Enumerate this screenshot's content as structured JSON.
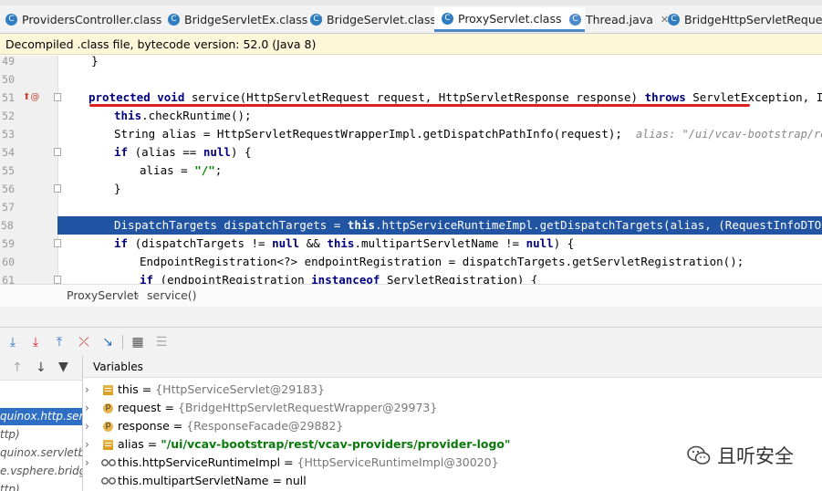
{
  "tabs": [
    {
      "label": "ProvidersController.class",
      "icon": "class-icon",
      "active": false
    },
    {
      "label": "BridgeServletEx.class",
      "icon": "class-icon",
      "active": false
    },
    {
      "label": "BridgeServlet.class",
      "icon": "class-icon",
      "active": false
    },
    {
      "label": "ProxyServlet.class",
      "icon": "class-icon",
      "active": true
    },
    {
      "label": "Thread.java",
      "icon": "java-class-icon",
      "active": false
    },
    {
      "label": "BridgeHttpServletRequestWr",
      "icon": "class-icon",
      "active": false
    }
  ],
  "info_bar": "Decompiled .class file, bytecode version: 52.0 (Java 8)",
  "code": {
    "lines": [
      {
        "n": "49",
        "text": "    }"
      },
      {
        "n": "50",
        "text": ""
      },
      {
        "n": "51",
        "text": "protected void service(HttpServletRequest request, HttpServletResponse response) throws ServletException, IOExcepti"
      },
      {
        "n": "52",
        "text": "    this.checkRuntime();"
      },
      {
        "n": "53",
        "text": "    String alias = HttpServletRequestWrapperImpl.getDispatchPathInfo(request);"
      },
      {
        "n": "54",
        "text": "    if (alias == null) {"
      },
      {
        "n": "55",
        "text": "        alias = \"/\";"
      },
      {
        "n": "56",
        "text": "    }"
      },
      {
        "n": "57",
        "text": ""
      },
      {
        "n": "58",
        "text": "    DispatchTargets dispatchTargets = this.httpServiceRuntimeImpl.getDispatchTargets(alias, (RequestInfoDTO)null);"
      },
      {
        "n": "59",
        "text": "    if (dispatchTargets != null && this.multipartServletName != null) {"
      },
      {
        "n": "60",
        "text": "        EndpointRegistration<?> endpointRegistration = dispatchTargets.getServletRegistration();"
      },
      {
        "n": "61",
        "text": "        if (endpointRegistration instanceof ServletRegistration) {"
      }
    ],
    "inline_hint": "alias: \"/ui/vcav-bootstrap/rest/vca"
  },
  "breadcrumb": [
    "ProxyServlet",
    "service()"
  ],
  "frames": [
    "quinox.http.servlet.",
    "ttp)",
    "quinox.servletbric",
    "e.vsphere.bridge,",
    "ttp)"
  ],
  "variables": {
    "header": "Variables",
    "rows": [
      {
        "icon": "field-icon",
        "name": "this",
        "value": "{HttpServiceServlet@29183}",
        "expandable": true
      },
      {
        "icon": "param-icon",
        "name": "request",
        "value": "{BridgeHttpServletRequestWrapper@29973}",
        "expandable": true
      },
      {
        "icon": "param-icon",
        "name": "response",
        "value": "{ResponseFacade@29882}",
        "expandable": true
      },
      {
        "icon": "field-icon",
        "name": "alias",
        "value": "\"/ui/vcav-bootstrap/rest/vcav-providers/provider-logo\"",
        "expandable": true
      },
      {
        "icon": "watch-icon",
        "name": "this.httpServiceRuntimeImpl",
        "value": "{HttpServiceRuntimeImpl@30020}",
        "expandable": true
      },
      {
        "icon": "watch-icon",
        "name": "this.multipartServletName",
        "value": "null",
        "expandable": false
      }
    ]
  },
  "watermark": "且听安全"
}
